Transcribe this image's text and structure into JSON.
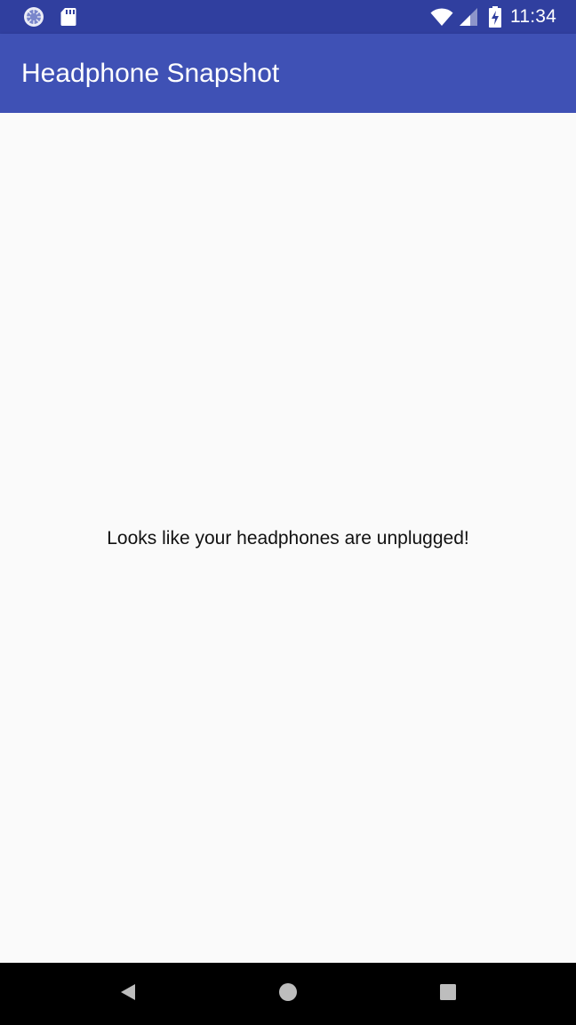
{
  "status_bar": {
    "time": "11:34",
    "icons": [
      "sync-spinner-icon",
      "sd-card-icon",
      "wifi-icon",
      "cell-signal-icon",
      "battery-charging-icon"
    ]
  },
  "app_bar": {
    "title": "Headphone Snapshot"
  },
  "main": {
    "message": "Looks like your headphones are unplugged!"
  },
  "nav_bar": {
    "icons": [
      "back-icon",
      "home-icon",
      "recents-icon"
    ]
  },
  "colors": {
    "status_bar": "#303f9f",
    "app_bar": "#3f51b5",
    "background": "#fafafa",
    "nav_bar": "#000000"
  }
}
